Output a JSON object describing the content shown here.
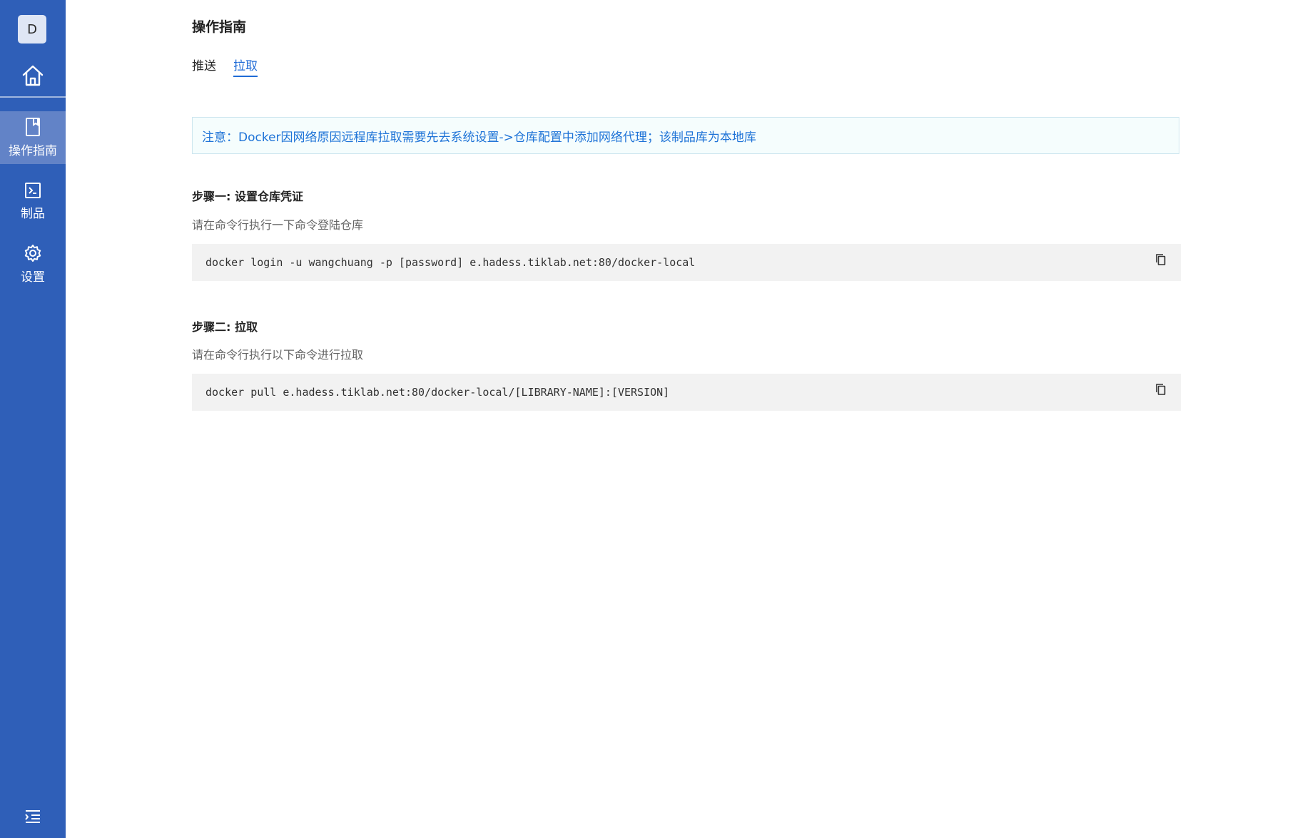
{
  "sidebar": {
    "avatar_letter": "D",
    "nav": [
      {
        "label": "操作指南",
        "icon": "book-icon",
        "active": true
      },
      {
        "label": "制品",
        "icon": "terminal-icon",
        "active": false
      },
      {
        "label": "设置",
        "icon": "gear-icon",
        "active": false
      }
    ],
    "home_icon": "home-icon",
    "collapse_icon": "menu-collapse-icon"
  },
  "main": {
    "title": "操作指南",
    "tabs": [
      {
        "label": "推送",
        "active": false
      },
      {
        "label": "拉取",
        "active": true
      }
    ],
    "notice": "注意：Docker因网络原因远程库拉取需要先去系统设置->仓库配置中添加网络代理；该制品库为本地库",
    "steps": [
      {
        "title": "步骤一: 设置仓库凭证",
        "description": "请在命令行执行一下命令登陆仓库",
        "command": "docker login -u wangchuang -p [password] e.hadess.tiklab.net:80/docker-local"
      },
      {
        "title": "步骤二: 拉取",
        "description": "请在命令行执行以下命令进行拉取",
        "command": "docker pull e.hadess.tiklab.net:80/docker-local/[LIBRARY-NAME]:[VERSION]"
      }
    ],
    "copy_icon": "copy-icon"
  },
  "colors": {
    "sidebar_bg": "#2f5fb8",
    "sidebar_active": "#6283c7",
    "accent": "#1f6bd6",
    "notice_bg": "#f5fdfd",
    "notice_border": "#cde6ef",
    "code_bg": "#f2f2f2"
  }
}
